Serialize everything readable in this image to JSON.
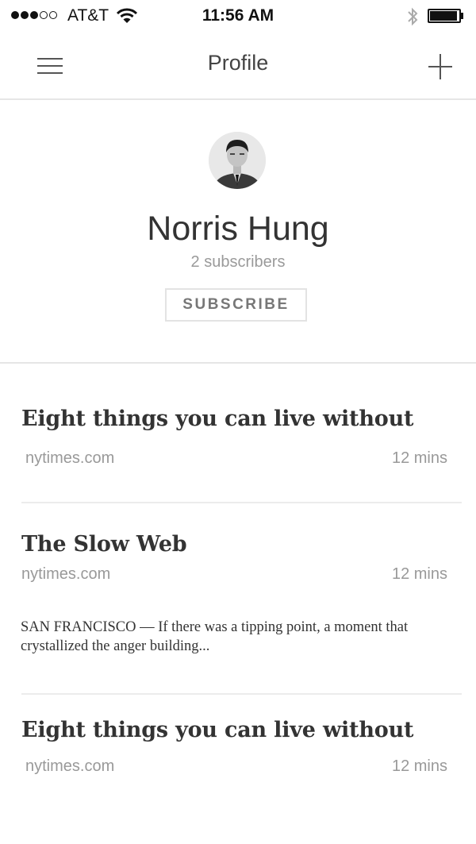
{
  "status_bar": {
    "carrier": "AT&T",
    "time": "11:56 AM",
    "signal_bars_filled": 3,
    "signal_bars_total": 5,
    "battery_level": 0.95
  },
  "nav": {
    "title": "Profile",
    "menu_icon": "hamburger-menu-icon",
    "add_icon": "plus-icon"
  },
  "profile": {
    "name": "Norris Hung",
    "subscribers": "2 subscribers",
    "subscribe_label": "SUBSCRIBE"
  },
  "articles": [
    {
      "title": "Eight things you can live without",
      "source": "nytimes.com",
      "time": "12 mins"
    },
    {
      "title": "The Slow Web",
      "source": "nytimes.com",
      "time": "12 mins",
      "excerpt": "SAN FRANCISCO — If there was a tipping point, a moment that crystallized the anger building..."
    },
    {
      "title": "Eight things you can live without",
      "source": "nytimes.com",
      "time": "12 mins"
    }
  ]
}
